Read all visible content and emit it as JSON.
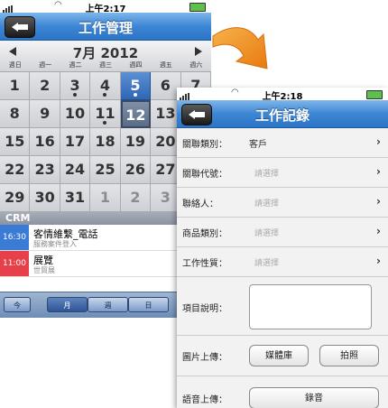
{
  "left_screen": {
    "status_time": "上午2:17",
    "nav_title": "工作管理",
    "month": "7月 2012",
    "weekdays": [
      "週日",
      "週一",
      "週二",
      "週三",
      "週四",
      "週五",
      "週六"
    ],
    "days": [
      {
        "d": "1",
        "other": false,
        "dot": false
      },
      {
        "d": "2",
        "other": false,
        "dot": false
      },
      {
        "d": "3",
        "other": false,
        "dot": true
      },
      {
        "d": "4",
        "other": false,
        "dot": true
      },
      {
        "d": "5",
        "other": false,
        "dot": true,
        "today": true
      },
      {
        "d": "6",
        "other": false,
        "dot": false
      },
      {
        "d": "7",
        "other": false,
        "dot": false
      },
      {
        "d": "8",
        "other": false,
        "dot": false
      },
      {
        "d": "9",
        "other": false,
        "dot": false
      },
      {
        "d": "10",
        "other": false,
        "dot": false
      },
      {
        "d": "11",
        "other": false,
        "dot": true
      },
      {
        "d": "12",
        "other": false,
        "dot": false,
        "selected": true
      },
      {
        "d": "13",
        "other": false,
        "dot": false
      },
      {
        "d": "14",
        "other": false,
        "dot": false
      },
      {
        "d": "15",
        "other": false,
        "dot": false
      },
      {
        "d": "16",
        "other": false,
        "dot": false
      },
      {
        "d": "17",
        "other": false,
        "dot": false
      },
      {
        "d": "18",
        "other": false,
        "dot": false
      },
      {
        "d": "19",
        "other": false,
        "dot": false
      },
      {
        "d": "20",
        "other": false,
        "dot": false
      },
      {
        "d": "21",
        "other": false,
        "dot": false
      },
      {
        "d": "22",
        "other": false,
        "dot": false
      },
      {
        "d": "23",
        "other": false,
        "dot": false
      },
      {
        "d": "24",
        "other": false,
        "dot": false
      },
      {
        "d": "25",
        "other": false,
        "dot": false
      },
      {
        "d": "26",
        "other": false,
        "dot": false
      },
      {
        "d": "27",
        "other": false,
        "dot": false
      },
      {
        "d": "28",
        "other": false,
        "dot": false
      },
      {
        "d": "29",
        "other": false,
        "dot": false
      },
      {
        "d": "30",
        "other": false,
        "dot": false
      },
      {
        "d": "31",
        "other": false,
        "dot": false
      },
      {
        "d": "1",
        "other": true,
        "dot": false
      },
      {
        "d": "2",
        "other": true,
        "dot": false
      },
      {
        "d": "3",
        "other": true,
        "dot": false
      },
      {
        "d": "4",
        "other": true,
        "dot": false
      }
    ],
    "section": "CRM",
    "events": [
      {
        "time": "16:30",
        "color": "#3a7bd5",
        "title": "客情維繫_電話",
        "sub": "服務案件登入"
      },
      {
        "time": "11:00",
        "color": "#e6404a",
        "title": "展覽",
        "sub": "世貿展"
      }
    ],
    "tabs": {
      "today": "今",
      "month": "月",
      "week": "週",
      "day": "日"
    }
  },
  "right_screen": {
    "status_time": "上午2:18",
    "nav_title": "工作記錄",
    "rows": [
      {
        "label": "關聯類別：",
        "value": "客戶"
      },
      {
        "label": "關聯代號：",
        "placeholder": "請選擇"
      },
      {
        "label": "聯絡人：",
        "placeholder": "請選擇"
      },
      {
        "label": "商品類別：",
        "placeholder": "請選擇"
      },
      {
        "label": "工作性質：",
        "placeholder": "請選擇"
      }
    ],
    "desc_label": "項目說明：",
    "image_label": "圖片上傳：",
    "media_button": "媒體庫",
    "photo_button": "拍照",
    "audio_label": "語音上傳：",
    "record_button": "錄音"
  },
  "colors": {
    "accent": "#2c74c6",
    "arrow": "#f0941e"
  }
}
